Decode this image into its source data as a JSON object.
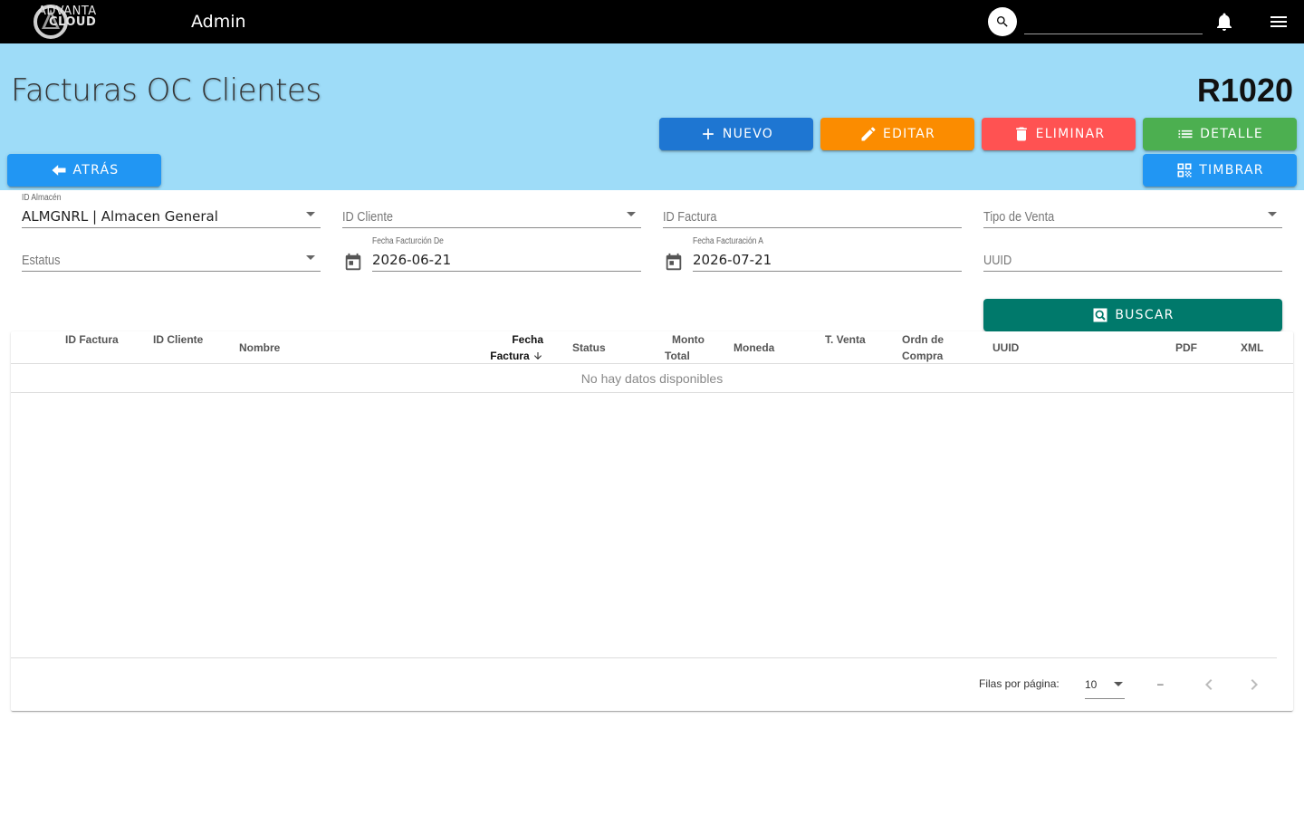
{
  "appbar": {
    "logo_line1": "ADVANTA",
    "logo_line2": "CLOUD",
    "title": "Admin",
    "search_placeholder": "",
    "icons": [
      "search-icon",
      "bell-icon",
      "menu-icon"
    ]
  },
  "header": {
    "title": "Facturas OC Clientes",
    "code": "R1020",
    "background": "#9edcf8"
  },
  "actions": {
    "new": "Nuevo",
    "edit": "Editar",
    "delete": "Eliminar",
    "detail": "Detalle",
    "back": "Atrás",
    "stamp": "Timbrar",
    "search": "Buscar"
  },
  "colors": {
    "new": "#1e76d2",
    "edit": "#fb8c00",
    "delete": "#ff5252",
    "detail": "#4caf50",
    "back": "#2196f3",
    "stamp": "#2196f3",
    "search": "#00796b"
  },
  "filters": {
    "almacen": {
      "label": "ID Almacén",
      "value": "ALMGNRL | Almacen General"
    },
    "cliente": {
      "placeholder": "ID Cliente"
    },
    "factura": {
      "placeholder": "ID Factura"
    },
    "tipo_venta": {
      "placeholder": "Tipo de Venta"
    },
    "estatus": {
      "placeholder": "Estatus"
    },
    "fecha_de": {
      "label": "Fecha Facturción De",
      "value": "2026-06-21"
    },
    "fecha_a": {
      "label": "Fecha Facturación A",
      "value": "2026-07-21"
    },
    "uuid": {
      "placeholder": "UUID"
    }
  },
  "table": {
    "columns": {
      "id_factura": "ID Factura",
      "id_cliente": "ID Cliente",
      "nombre": "Nombre",
      "fecha_1": "Fecha",
      "fecha_2": "Factura",
      "status": "Status",
      "monto_1": "Monto",
      "monto_2": "Total",
      "moneda": "Moneda",
      "t_venta": "T. Venta",
      "orden_1": "Ordn de",
      "orden_2": "Compra",
      "uuid": "UUID",
      "pdf": "PDF",
      "xml": "XML"
    },
    "sorted_column": "Fecha Factura",
    "sort_direction": "descending",
    "empty_text": "No hay datos disponibles",
    "rows_per_page_label": "Filas por página:",
    "rows_per_page": "10",
    "range_text": "–"
  }
}
